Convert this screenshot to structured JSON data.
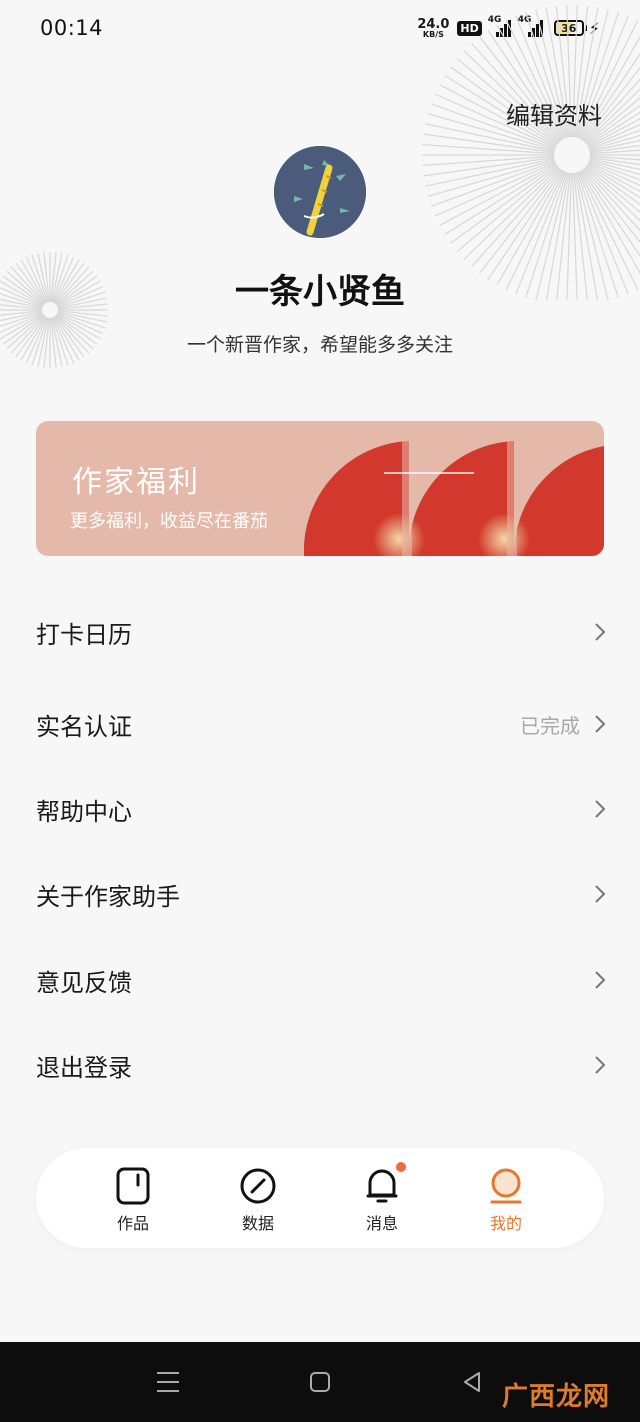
{
  "status_bar": {
    "time": "00:14",
    "net_speed_value": "24.0",
    "net_speed_unit": "KB/S",
    "hd_badge": "HD",
    "signal1_label": "4G",
    "signal2_label": "4G",
    "battery_level": "36",
    "battery_charging": true
  },
  "header": {
    "edit_profile": "编辑资料"
  },
  "profile": {
    "username": "一条小贤鱼",
    "bio": "一个新晋作家，希望能多多关注"
  },
  "banner": {
    "title": "作家福利",
    "subtitle": "更多福利，收益尽在番茄",
    "colors": {
      "background": "#e5b9aa",
      "accent": "#d2382b"
    }
  },
  "menu": {
    "items": [
      {
        "label": "打卡日历",
        "status": ""
      },
      {
        "label": "实名认证",
        "status": "已完成"
      },
      {
        "label": "帮助中心",
        "status": ""
      },
      {
        "label": "关于作家助手",
        "status": ""
      },
      {
        "label": "意见反馈",
        "status": ""
      },
      {
        "label": "退出登录",
        "status": ""
      }
    ]
  },
  "tabbar": {
    "tabs": [
      {
        "label": "作品",
        "icon": "works-icon",
        "active": false
      },
      {
        "label": "数据",
        "icon": "data-icon",
        "active": false
      },
      {
        "label": "消息",
        "icon": "bell-icon",
        "active": false,
        "badge": true
      },
      {
        "label": "我的",
        "icon": "profile-icon",
        "active": true
      }
    ],
    "active_color": "#e8772b"
  },
  "watermark": "广西龙网"
}
